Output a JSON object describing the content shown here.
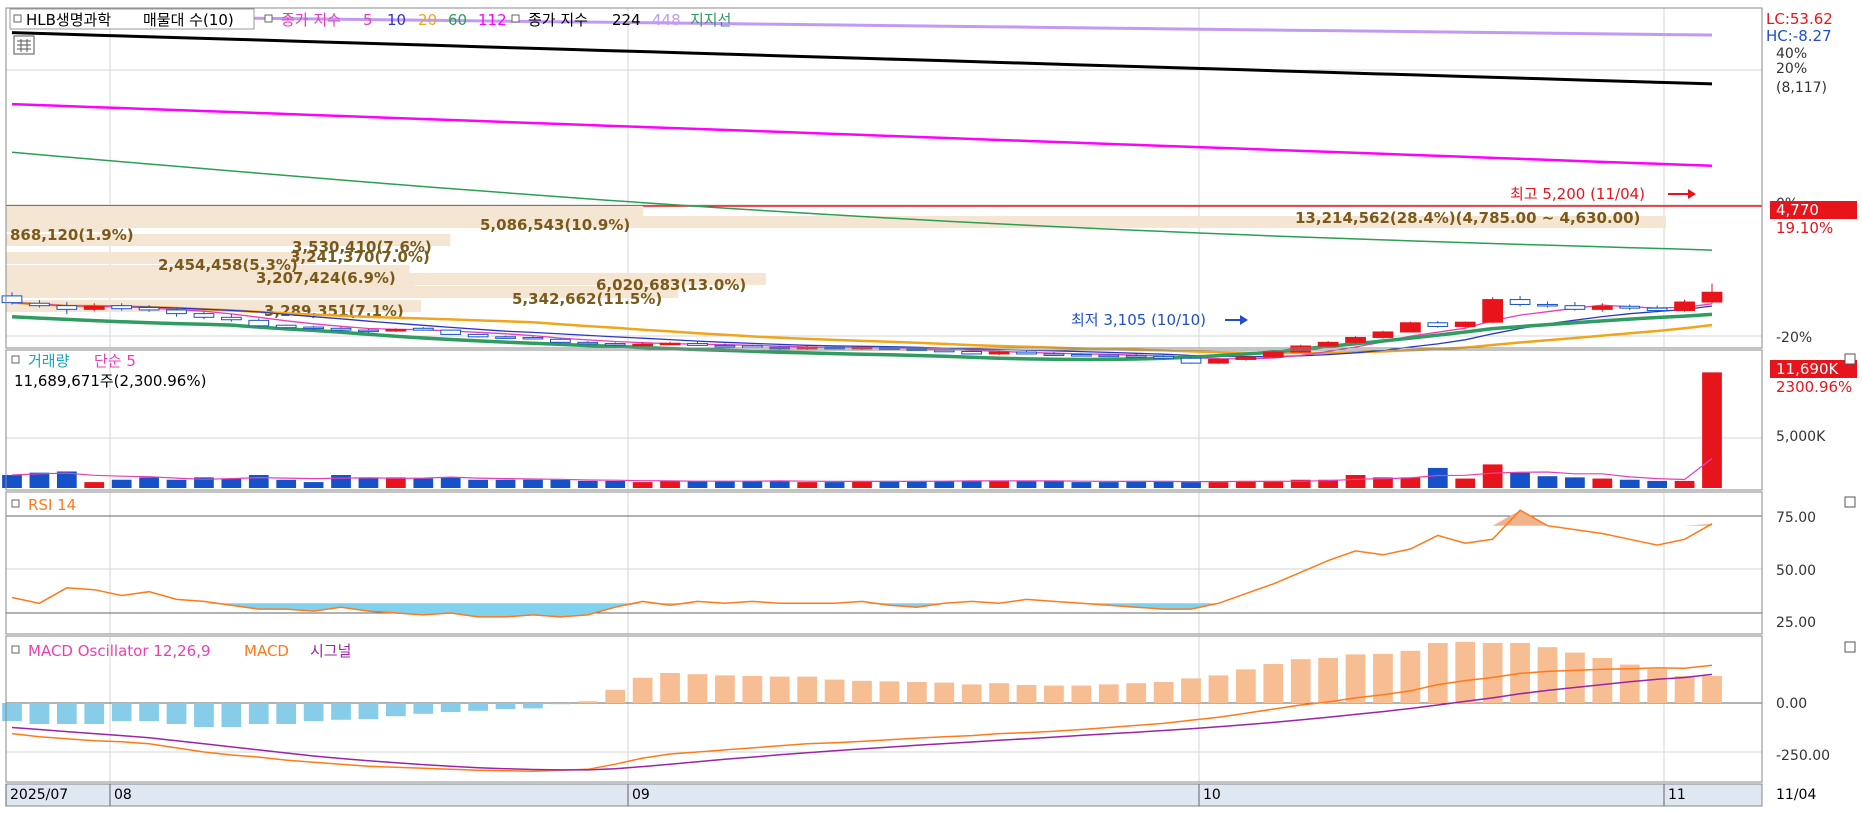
{
  "colors": {
    "up": "#e8141b",
    "down": "#1551c9",
    "grid": "#d6d6d6",
    "border": "#8a8a8a",
    "ma5": "#e83fb8",
    "ma10": "#2a38c6",
    "ma20": "#f0a51b",
    "ma60": "#2aa052",
    "ma112": "#ff00ff",
    "ma224": "#000000",
    "ma448": "#c29af5",
    "support": "#2f9c60",
    "volProfile": "#f5e6d3",
    "volProfileText": "#7a5a1a",
    "rsi": "#ff7a1a",
    "rsiFill": "#7fd1ee",
    "rsiOverFill": "#f1b48a",
    "macd": "#ff7a1a",
    "signal": "#9b24a9",
    "oscPos": "#f7bd93",
    "oscNeg": "#87cde9",
    "priceTag": "#e8141b",
    "blueLabel": "#1f4fcf",
    "bottomAxisBg": "#dfe7f2"
  },
  "legend": {
    "stock": "HLB생명과학",
    "profile": "매물대 수(10)",
    "ma_title": "종가 지수",
    "ma_5": "5",
    "ma_10": "10",
    "ma_20": "20",
    "ma_60": "60",
    "ma_112": "112",
    "ma2_title": "종가 지수",
    "ma_224": "224",
    "ma_448": "448",
    "support": "지지선"
  },
  "price_axis": {
    "lc": "LC:53.62",
    "hc": "HC:-8.27",
    "p40": "40%",
    "p20": "20%",
    "p20v": "(8,117)",
    "p0": "0%",
    "current_price": "4,770",
    "current_pct": "19.10%",
    "m20": "-20%"
  },
  "annotations": {
    "high": "최고 5,200 (11/04)",
    "low": "최저 3,105 (10/10)",
    "profile_top": "13,214,562(28.4%)(4,785.00 ~ 4,630.00)"
  },
  "volume_profile": [
    {
      "label": "868,120(1.9%)",
      "value": 1.9
    },
    {
      "label": "5,086,543(10.9%)",
      "value": 10.9
    },
    {
      "label": "3,530,410(7.6%)",
      "value": 7.6
    },
    {
      "label": "2,454,458(5.3%)",
      "value": 5.3
    },
    {
      "label": "3,207,424(6.9%)",
      "value": 6.9
    },
    {
      "label": "3,241,370(7.0%)",
      "value": 7.0
    },
    {
      "label": "6,020,683(13.0%)",
      "value": 13.0
    },
    {
      "label": "5,342,662(11.5%)",
      "value": 11.5
    },
    {
      "label": "3,289,351(7.1%)",
      "value": 7.1
    }
  ],
  "volume_panel": {
    "title": "거래량",
    "ma_label": "단순 5",
    "info": "11,689,671주(2,300.96%)",
    "tag": "11,690K",
    "tag_pct": "2300.96%",
    "tick": "5,000K"
  },
  "rsi_panel": {
    "title": "RSI 14",
    "t75": "75.00",
    "t50": "50.00",
    "t25": "25.00"
  },
  "macd_panel": {
    "title": "MACD Oscillator 12,26,9",
    "macd_label": "MACD",
    "signal_label": "시그널",
    "t0": "0.00",
    "tm250": "-250.00"
  },
  "x_axis": {
    "l1": "2025/07",
    "l2": "08",
    "l3": "09",
    "l4": "10",
    "l5": "11",
    "right": "11/04"
  },
  "chart_data": {
    "type": "candlestick",
    "price_range": [
      2700,
      8200
    ],
    "candles": [
      [
        3520,
        3580,
        3380,
        3410
      ],
      [
        3400,
        3450,
        3330,
        3360
      ],
      [
        3360,
        3420,
        3220,
        3300
      ],
      [
        3300,
        3400,
        3270,
        3350
      ],
      [
        3360,
        3400,
        3280,
        3310
      ],
      [
        3330,
        3370,
        3260,
        3290
      ],
      [
        3290,
        3310,
        3180,
        3230
      ],
      [
        3230,
        3260,
        3140,
        3170
      ],
      [
        3170,
        3220,
        3100,
        3130
      ],
      [
        3120,
        3150,
        3010,
        3030
      ],
      [
        3040,
        3050,
        2980,
        3000
      ],
      [
        3010,
        3030,
        2960,
        2990
      ],
      [
        2990,
        3010,
        2940,
        2960
      ],
      [
        2960,
        2980,
        2920,
        2950
      ],
      [
        2960,
        2990,
        2930,
        2970
      ],
      [
        2990,
        3010,
        2950,
        2960
      ],
      [
        2960,
        2970,
        2880,
        2890
      ],
      [
        2890,
        2900,
        2840,
        2850
      ],
      [
        2850,
        2870,
        2820,
        2830
      ],
      [
        2840,
        2860,
        2810,
        2820
      ],
      [
        2810,
        2830,
        2750,
        2760
      ],
      [
        2760,
        2780,
        2720,
        2740
      ],
      [
        2740,
        2760,
        2700,
        2720
      ],
      [
        2720,
        2760,
        2700,
        2730
      ],
      [
        2730,
        2770,
        2720,
        2745
      ],
      [
        2740,
        2780,
        2700,
        2710
      ],
      [
        2710,
        2740,
        2690,
        2700
      ],
      [
        2700,
        2720,
        2660,
        2670
      ],
      [
        2680,
        2700,
        2640,
        2660
      ],
      [
        2660,
        2700,
        2640,
        2680
      ],
      [
        2680,
        2700,
        2650,
        2660
      ],
      [
        2660,
        2690,
        2640,
        2680
      ],
      [
        2680,
        2700,
        2640,
        2650
      ],
      [
        2650,
        2670,
        2620,
        2630
      ],
      [
        2630,
        2650,
        2600,
        2610
      ],
      [
        2610,
        2640,
        2560,
        2570
      ],
      [
        2570,
        2620,
        2550,
        2600
      ],
      [
        2600,
        2630,
        2560,
        2570
      ],
      [
        2570,
        2600,
        2540,
        2560
      ],
      [
        2560,
        2580,
        2530,
        2550
      ],
      [
        2550,
        2570,
        2530,
        2540
      ],
      [
        2540,
        2580,
        2520,
        2530
      ],
      [
        2530,
        2550,
        2480,
        2500
      ],
      [
        2500,
        2520,
        2410,
        2420
      ],
      [
        2420,
        2500,
        2410,
        2480
      ],
      [
        2480,
        2530,
        2460,
        2520
      ],
      [
        2520,
        2620,
        2510,
        2600
      ],
      [
        2600,
        2720,
        2590,
        2700
      ],
      [
        2700,
        2780,
        2680,
        2760
      ],
      [
        2760,
        2860,
        2740,
        2840
      ],
      [
        2840,
        2950,
        2820,
        2930
      ],
      [
        2930,
        3100,
        2920,
        3080
      ],
      [
        3080,
        3110,
        3000,
        3020
      ],
      [
        3020,
        3100,
        2990,
        3090
      ],
      [
        3090,
        3500,
        3080,
        3460
      ],
      [
        3460,
        3520,
        3350,
        3380
      ],
      [
        3380,
        3430,
        3330,
        3360
      ],
      [
        3360,
        3420,
        3280,
        3300
      ],
      [
        3300,
        3400,
        3260,
        3350
      ],
      [
        3350,
        3380,
        3290,
        3320
      ],
      [
        3320,
        3360,
        3250,
        3280
      ],
      [
        3280,
        3460,
        3260,
        3420
      ],
      [
        3420,
        3720,
        3400,
        3580
      ]
    ],
    "volume": [
      0.11,
      0.13,
      0.14,
      0.05,
      0.07,
      0.09,
      0.07,
      0.09,
      0.08,
      0.11,
      0.07,
      0.05,
      0.11,
      0.09,
      0.09,
      0.08,
      0.09,
      0.07,
      0.07,
      0.07,
      0.07,
      0.06,
      0.06,
      0.05,
      0.06,
      0.06,
      0.06,
      0.06,
      0.06,
      0.05,
      0.05,
      0.06,
      0.06,
      0.06,
      0.06,
      0.06,
      0.06,
      0.06,
      0.06,
      0.05,
      0.05,
      0.06,
      0.06,
      0.05,
      0.05,
      0.06,
      0.06,
      0.07,
      0.07,
      0.11,
      0.09,
      0.09,
      0.17,
      0.08,
      0.2,
      0.13,
      0.1,
      0.09,
      0.08,
      0.07,
      0.06,
      0.06,
      0.98
    ],
    "rsi": [
      33,
      30,
      38,
      37,
      34,
      36,
      32,
      31,
      29,
      27,
      27,
      26,
      28,
      26,
      25,
      24,
      25,
      23,
      23,
      24,
      23,
      24,
      28,
      31,
      29,
      31,
      30,
      31,
      30,
      30,
      30,
      31,
      29,
      28,
      30,
      31,
      30,
      32,
      31,
      30,
      29,
      28,
      27,
      27,
      30,
      35,
      40,
      46,
      52,
      57,
      55,
      58,
      65,
      61,
      63,
      78,
      70,
      68,
      66,
      63,
      60,
      63,
      71
    ],
    "macd": [
      -150,
      -165,
      -175,
      -185,
      -190,
      -200,
      -220,
      -240,
      -255,
      -265,
      -280,
      -290,
      -300,
      -310,
      -315,
      -320,
      -325,
      -330,
      -332,
      -335,
      -330,
      -325,
      -300,
      -270,
      -250,
      -240,
      -230,
      -220,
      -210,
      -200,
      -195,
      -188,
      -180,
      -172,
      -165,
      -160,
      -150,
      -145,
      -138,
      -130,
      -120,
      -110,
      -100,
      -85,
      -70,
      -50,
      -30,
      -10,
      5,
      25,
      40,
      60,
      90,
      110,
      125,
      145,
      155,
      160,
      165,
      168,
      172,
      170,
      185
    ],
    "signal": [
      -120,
      -130,
      -140,
      -150,
      -160,
      -170,
      -185,
      -200,
      -215,
      -230,
      -245,
      -260,
      -272,
      -283,
      -293,
      -302,
      -310,
      -317,
      -322,
      -326,
      -328,
      -328,
      -322,
      -312,
      -300,
      -288,
      -276,
      -265,
      -254,
      -244,
      -234,
      -225,
      -216,
      -207,
      -199,
      -191,
      -183,
      -175,
      -167,
      -159,
      -151,
      -143,
      -135,
      -126,
      -116,
      -106,
      -95,
      -83,
      -70,
      -56,
      -42,
      -27,
      -10,
      8,
      25,
      45,
      62,
      76,
      90,
      104,
      116,
      125,
      140
    ],
    "ma_lines": {
      "ma448": {
        "start": 8110,
        "end": 7790
      },
      "ma224": {
        "start": 7830,
        "end": 6990
      },
      "ma112": {
        "start": 6660,
        "end": 5650
      },
      "ma60": {
        "start": 5870,
        "end": 4270
      }
    }
  }
}
